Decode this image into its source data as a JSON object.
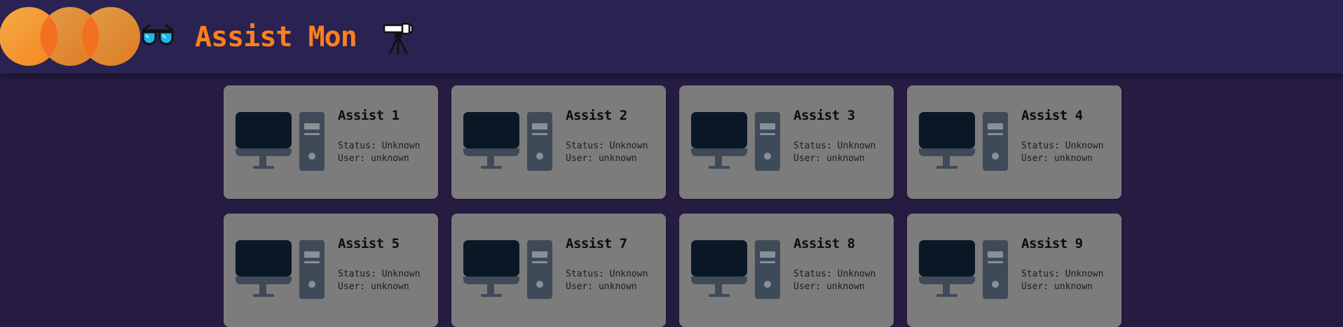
{
  "header": {
    "title": "Assist Mon",
    "icons": [
      "logo-rings",
      "glasses-icon",
      "telescope-icon"
    ],
    "accent_color": "#ff7f1e",
    "background_color": "#2a2250"
  },
  "status_label": "Status:",
  "user_label": "User:",
  "machines": [
    {
      "name": "Assist 1",
      "status": "Unknown",
      "user": "unknown"
    },
    {
      "name": "Assist 2",
      "status": "Unknown",
      "user": "unknown"
    },
    {
      "name": "Assist 3",
      "status": "Unknown",
      "user": "unknown"
    },
    {
      "name": "Assist 4",
      "status": "Unknown",
      "user": "unknown"
    },
    {
      "name": "Assist 5",
      "status": "Unknown",
      "user": "unknown"
    },
    {
      "name": "Assist 7",
      "status": "Unknown",
      "user": "unknown"
    },
    {
      "name": "Assist 8",
      "status": "Unknown",
      "user": "unknown"
    },
    {
      "name": "Assist 9",
      "status": "Unknown",
      "user": "unknown"
    }
  ],
  "colors": {
    "page_background": "#261c42",
    "card_background": "#7c7c7c",
    "monitor_screen": "#0a1825",
    "device_body": "#3f4a58"
  }
}
